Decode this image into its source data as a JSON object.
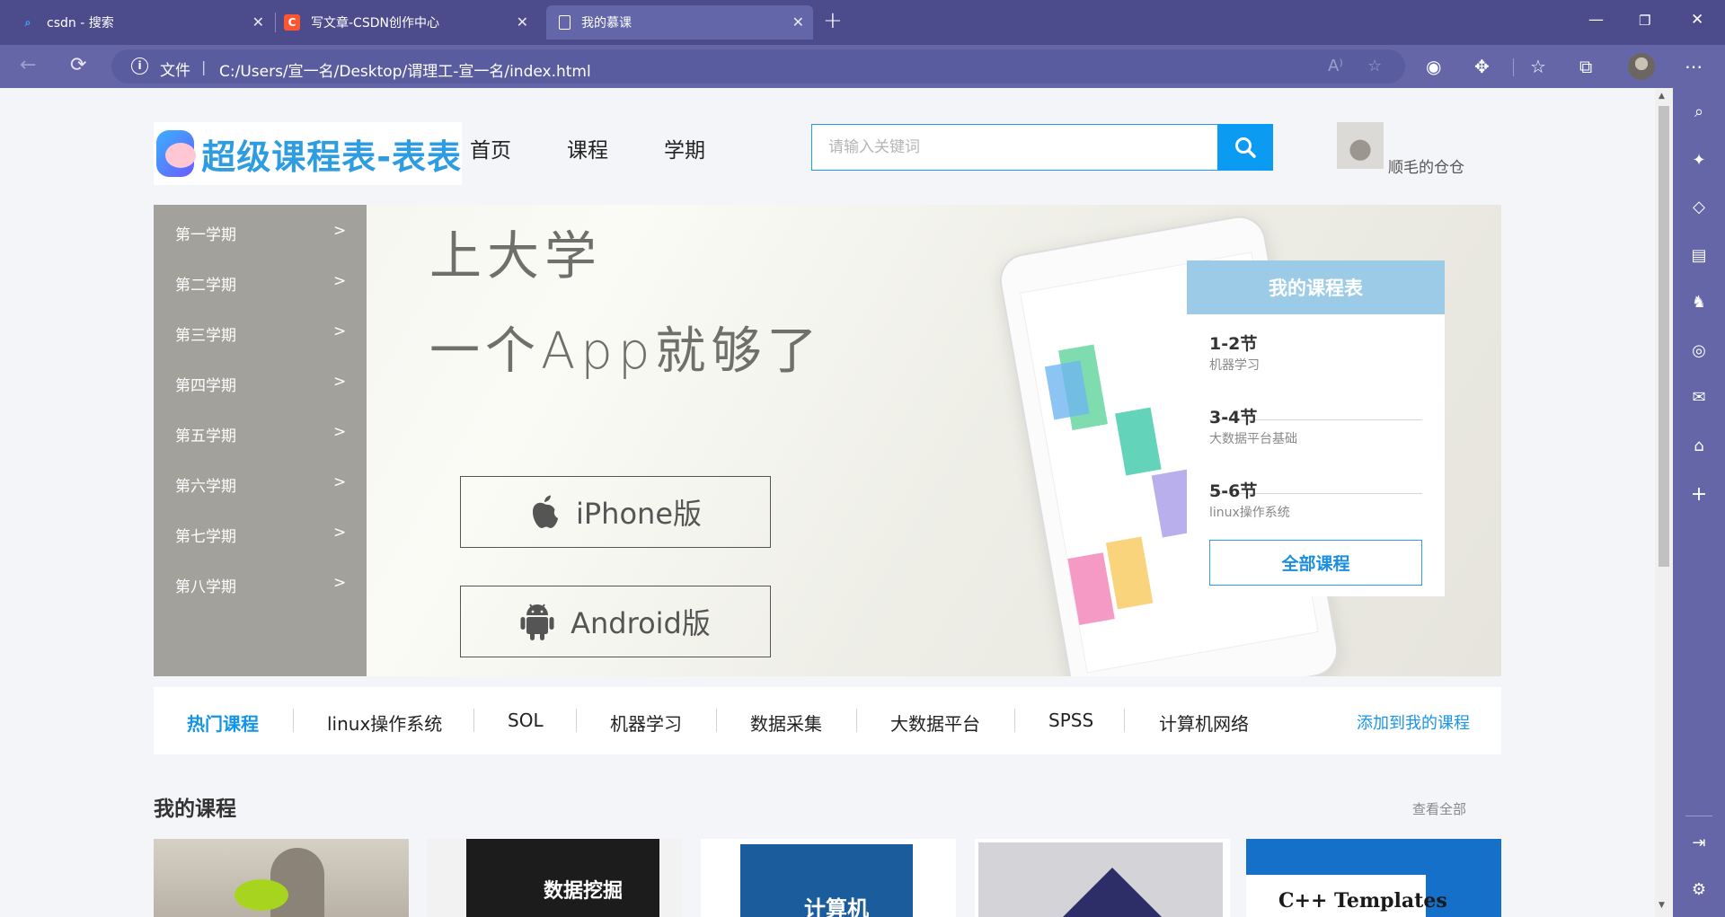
{
  "browser": {
    "tabs": [
      {
        "title": "csdn - 搜索",
        "active": false,
        "icon": "search-icon"
      },
      {
        "title": "写文章-CSDN创作中心",
        "active": false,
        "icon": "csdn-icon"
      },
      {
        "title": "我的慕课",
        "active": true,
        "icon": "page-icon"
      }
    ],
    "address": {
      "label": "文件",
      "url": "C:/Users/宣一名/Desktop/谓理工-宣一名/index.html"
    },
    "accent": "#6466a8"
  },
  "site": {
    "logo_text": "超级课程表-表表",
    "nav": [
      "首页",
      "课程",
      "学期"
    ],
    "search": {
      "placeholder": "请输入关键词",
      "value": ""
    },
    "username": "顺毛的仓仓"
  },
  "banner": {
    "semesters": [
      "第一学期",
      "第二学期",
      "第三学期",
      "第四学期",
      "第五学期",
      "第六学期",
      "第七学期",
      "第八学期"
    ],
    "arrow": ">",
    "slogan_line1": "上大学",
    "slogan_line2": "一个App就够了",
    "download_buttons": [
      {
        "label": "iPhone版",
        "icon": "apple-icon"
      },
      {
        "label": "Android版",
        "icon": "android-icon"
      }
    ],
    "schedule": {
      "title": "我的课程表",
      "items": [
        {
          "time": "1-2节",
          "course": "机器学习"
        },
        {
          "time": "3-4节",
          "course": "大数据平台基础"
        },
        {
          "time": "5-6节",
          "course": "linux操作系统"
        }
      ],
      "all_label": "全部课程"
    }
  },
  "hot": {
    "active": "热门课程",
    "items": [
      "linux操作系统",
      "SOL",
      "机器学习",
      "数据采集",
      "大数据平台",
      "SPSS",
      "计算机网络"
    ],
    "add_label": "添加到我的课程"
  },
  "my_courses": {
    "title": "我的课程",
    "view_all": "查看全部",
    "books": [
      {
        "title": ""
      },
      {
        "title": "数据挖掘"
      },
      {
        "title": "计算机"
      },
      {
        "title": ""
      },
      {
        "title": "C++ Templates"
      }
    ]
  }
}
